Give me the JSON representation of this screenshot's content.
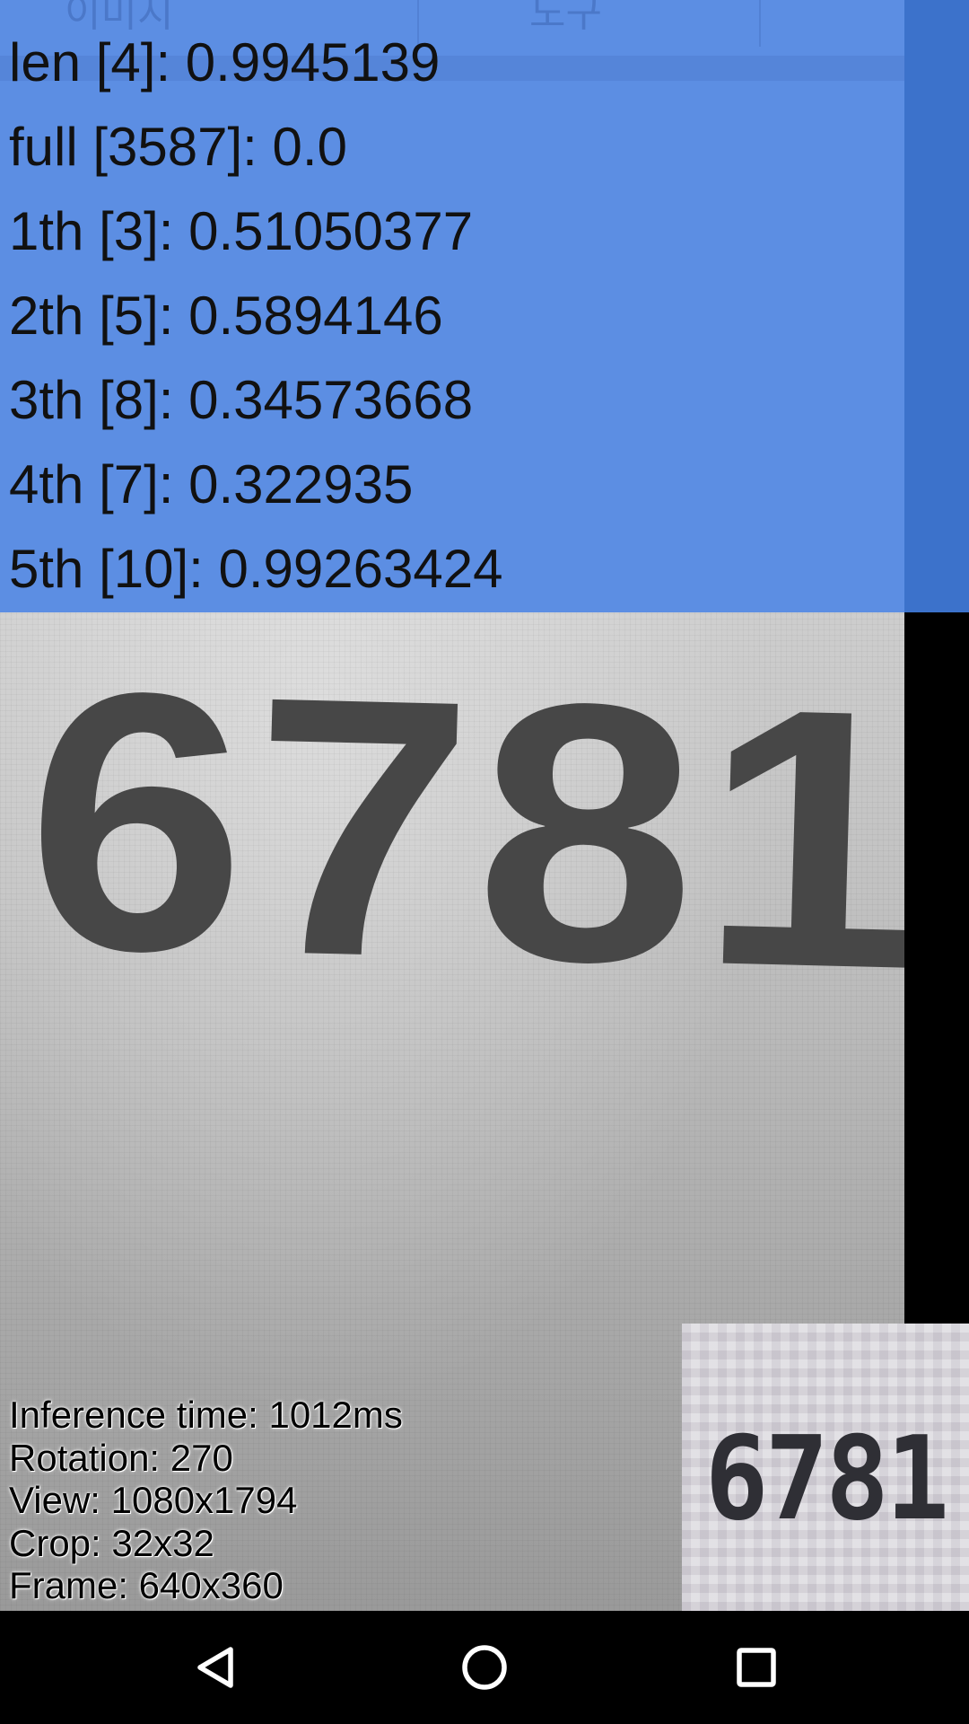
{
  "background_tabs": [
    "이미지",
    "도구"
  ],
  "results": [
    "len [4]: 0.9945139",
    "full [3587]: 0.0",
    "1th [3]: 0.51050377",
    "2th [5]: 0.5894146",
    "3th [8]: 0.34573668",
    "4th [7]: 0.322935",
    "5th [10]: 0.99263424"
  ],
  "camera": {
    "number_text": "6781"
  },
  "debug": {
    "inference_time": "Inference time: 1012ms",
    "rotation": "Rotation: 270",
    "view": "View: 1080x1794",
    "crop": "Crop: 32x32",
    "frame": "Frame: 640x360"
  },
  "crop_preview": {
    "digits": "6781"
  },
  "nav": {
    "back_icon": "back-triangle-icon",
    "home_icon": "home-circle-icon",
    "recents_icon": "recents-square-icon"
  },
  "colors": {
    "panel_blue": "#5c8ee3",
    "panel_edge_blue": "#3c72cb",
    "nav_background": "#000000",
    "nav_icon": "#ffffff"
  }
}
